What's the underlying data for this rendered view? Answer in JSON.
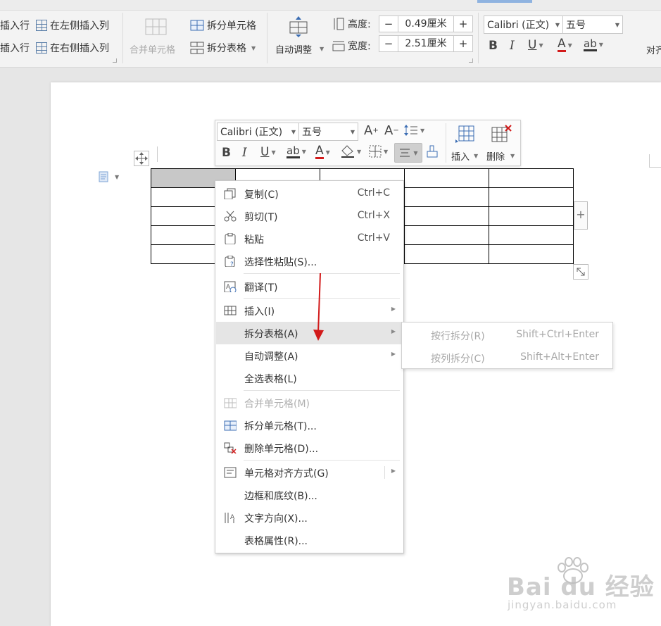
{
  "ribbon": {
    "insert_row_above": "插入行",
    "insert_row_below": "插入行",
    "insert_col_left": "在左侧插入列",
    "insert_col_right": "在右侧插入列",
    "merge_cells": "合并单元格",
    "split_cells": "拆分单元格",
    "split_table": "拆分表格",
    "auto_fit": "自动调整",
    "height_label": "高度:",
    "height_value": "0.49厘米",
    "width_label": "宽度:",
    "width_value": "2.51厘米",
    "font_name": "Calibri (正文)",
    "font_size": "五号",
    "align_partial": "对齐"
  },
  "mini_toolbar": {
    "font_name": "Calibri (正文)",
    "font_size": "五号",
    "insert_label": "插入",
    "delete_label": "删除"
  },
  "context_menu": {
    "items": [
      {
        "label": "复制(C)",
        "shortcut": "Ctrl+C"
      },
      {
        "label": "剪切(T)",
        "shortcut": "Ctrl+X"
      },
      {
        "label": "粘贴",
        "shortcut": "Ctrl+V"
      },
      {
        "label": "选择性粘贴(S)..."
      },
      {
        "label": "翻译(T)"
      },
      {
        "label": "插入(I)"
      },
      {
        "label": "拆分表格(A)"
      },
      {
        "label": "自动调整(A)"
      },
      {
        "label": "全选表格(L)"
      },
      {
        "label": "合并单元格(M)"
      },
      {
        "label": "拆分单元格(T)..."
      },
      {
        "label": "删除单元格(D)..."
      },
      {
        "label": "单元格对齐方式(G)"
      },
      {
        "label": "边框和底纹(B)..."
      },
      {
        "label": "文字方向(X)..."
      },
      {
        "label": "表格属性(R)..."
      }
    ]
  },
  "submenu": {
    "items": [
      {
        "label": "按行拆分(R)",
        "shortcut": "Shift+Ctrl+Enter"
      },
      {
        "label": "按列拆分(C)",
        "shortcut": "Shift+Alt+Enter"
      }
    ]
  },
  "watermark": {
    "brand": "Bai du 经验",
    "url": "jingyan.baidu.com"
  },
  "colors": {
    "arrow": "#d21a1a",
    "accent_blue": "#3b6db3",
    "highlight": "#e5e5e5",
    "selected_cell": "#c8c8c8"
  }
}
